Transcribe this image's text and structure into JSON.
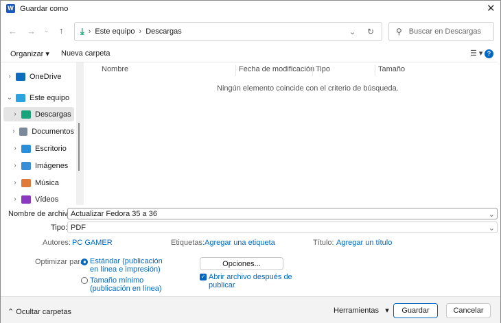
{
  "title": "Guardar como",
  "address": {
    "crumbs": [
      "Este equipo",
      "Descargas"
    ]
  },
  "search": {
    "placeholder": "Buscar en Descargas"
  },
  "toolbar": {
    "organize": "Organizar",
    "new_folder": "Nueva carpeta"
  },
  "nav": [
    {
      "label": "OneDrive",
      "icon": "cloud-icon",
      "color": "#0f6cbd"
    },
    {
      "label": "Este equipo",
      "icon": "computer-icon",
      "color": "#2aa3e0"
    },
    {
      "label": "Descargas",
      "icon": "download-icon",
      "color": "#1aa37a",
      "selected": true
    },
    {
      "label": "Documentos",
      "icon": "documents-icon",
      "color": "#7b8a9a"
    },
    {
      "label": "Escritorio",
      "icon": "desktop-icon",
      "color": "#2a8fd8"
    },
    {
      "label": "Imágenes",
      "icon": "pictures-icon",
      "color": "#3a8ed6"
    },
    {
      "label": "Música",
      "icon": "music-icon",
      "color": "#e07a3a"
    },
    {
      "label": "Vídeos",
      "icon": "videos-icon",
      "color": "#8a3ac0"
    }
  ],
  "columns": [
    "Nombre",
    "Fecha de modificación",
    "Tipo",
    "Tamaño"
  ],
  "empty_message": "Ningún elemento coincide con el criterio de búsqueda.",
  "form": {
    "filename_label": "Nombre de archivo:",
    "filename": "Actualizar Fedora 35 a 36",
    "type_label": "Tipo:",
    "type": "PDF",
    "authors_label": "Autores:",
    "authors": "PC GAMER",
    "tags_label": "Etiquetas:",
    "tags": "Agregar una etiqueta",
    "title_label": "Título:",
    "title_value": "Agregar un título",
    "optimize_label": "Optimizar para:",
    "opt_standard_1": "Estándar (publicación",
    "opt_standard_2": "en línea e impresión)",
    "opt_min_1": "Tamaño mínimo",
    "opt_min_2": "(publicación en línea)",
    "options_button": "Opciones...",
    "open_after_1": "Abrir archivo después de",
    "open_after_2": "publicar",
    "open_after_checked": true
  },
  "footer": {
    "hide_folders": "Ocultar carpetas",
    "tools": "Herramientas",
    "save": "Guardar",
    "cancel": "Cancelar"
  },
  "accent": "#0067c0"
}
